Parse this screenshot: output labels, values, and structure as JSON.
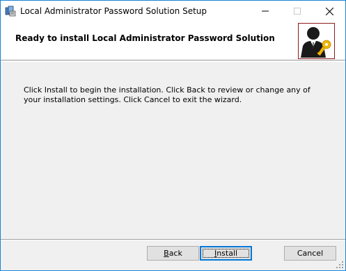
{
  "window": {
    "title": "Local Administrator Password Solution Setup",
    "icon": "msi-installer-icon"
  },
  "caption_buttons": {
    "minimize_icon": "minimize-icon",
    "maximize_icon": "maximize-icon",
    "close_icon": "close-icon"
  },
  "banner": {
    "title": "Ready to install Local Administrator Password Solution",
    "image": "admin-key-icon"
  },
  "body": {
    "text": "Click Install to begin the installation. Click Back to review or change any of your installation settings. Click Cancel to exit the wizard."
  },
  "buttons": {
    "back": {
      "mnemonic": "B",
      "rest": "ack"
    },
    "install": {
      "mnemonic": "I",
      "rest": "nstall"
    },
    "cancel": "Cancel"
  },
  "colors": {
    "window_border": "#1883d7",
    "default_button_border": "#0078d7",
    "banner_image_border": "#8b1a1a",
    "key_gold": "#f2b705"
  }
}
